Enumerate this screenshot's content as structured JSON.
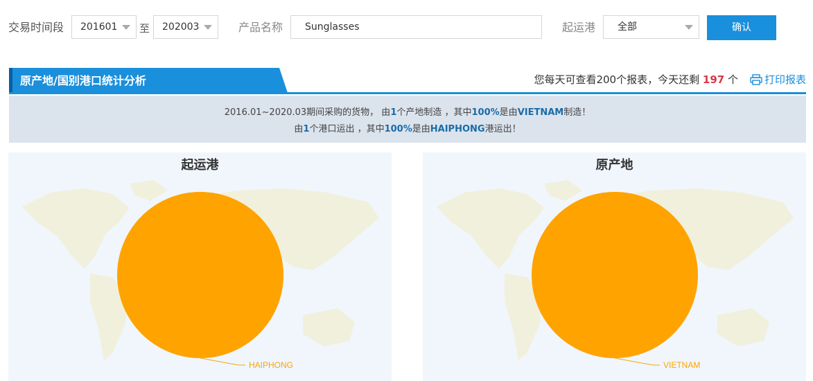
{
  "filters": {
    "period_label": "交易时间段",
    "period_from": "201601",
    "period_sep": "至",
    "period_to": "202003",
    "product_label": "产品名称",
    "product_value": "Sunglasses",
    "port_label": "起运港",
    "port_value": "全部",
    "confirm_label": "确认"
  },
  "section": {
    "tab_title": "原产地/国别港口统计分析",
    "quota_prefix": "您每天可查看200个报表，今天还剩",
    "quota_remaining": "197",
    "quota_suffix": "个",
    "print_label": "打印报表"
  },
  "summary": {
    "l1_a": "2016.01~2020.03期间采购的货物， 由",
    "l1_n": "1",
    "l1_b": "个产地制造 ，其中",
    "l1_p": "100%",
    "l1_c": "是由",
    "l1_country": "VIETNAM",
    "l1_d": "制造！",
    "l2_a": "由",
    "l2_n": "1",
    "l2_b": "个港口运出 ，其中",
    "l2_p": "100%",
    "l2_c": "是由",
    "l2_port": "HAIPHONG",
    "l2_d": "港运出！"
  },
  "colors": {
    "accent": "#1a8fdc",
    "slice": "#ffa300",
    "quota_num": "#d9384a"
  },
  "chart_data": [
    {
      "type": "pie",
      "title": "起运港",
      "labels": [
        "HAIPHONG"
      ],
      "values": [
        100
      ]
    },
    {
      "type": "pie",
      "title": "原产地",
      "labels": [
        "VIETNAM"
      ],
      "values": [
        100
      ]
    }
  ]
}
